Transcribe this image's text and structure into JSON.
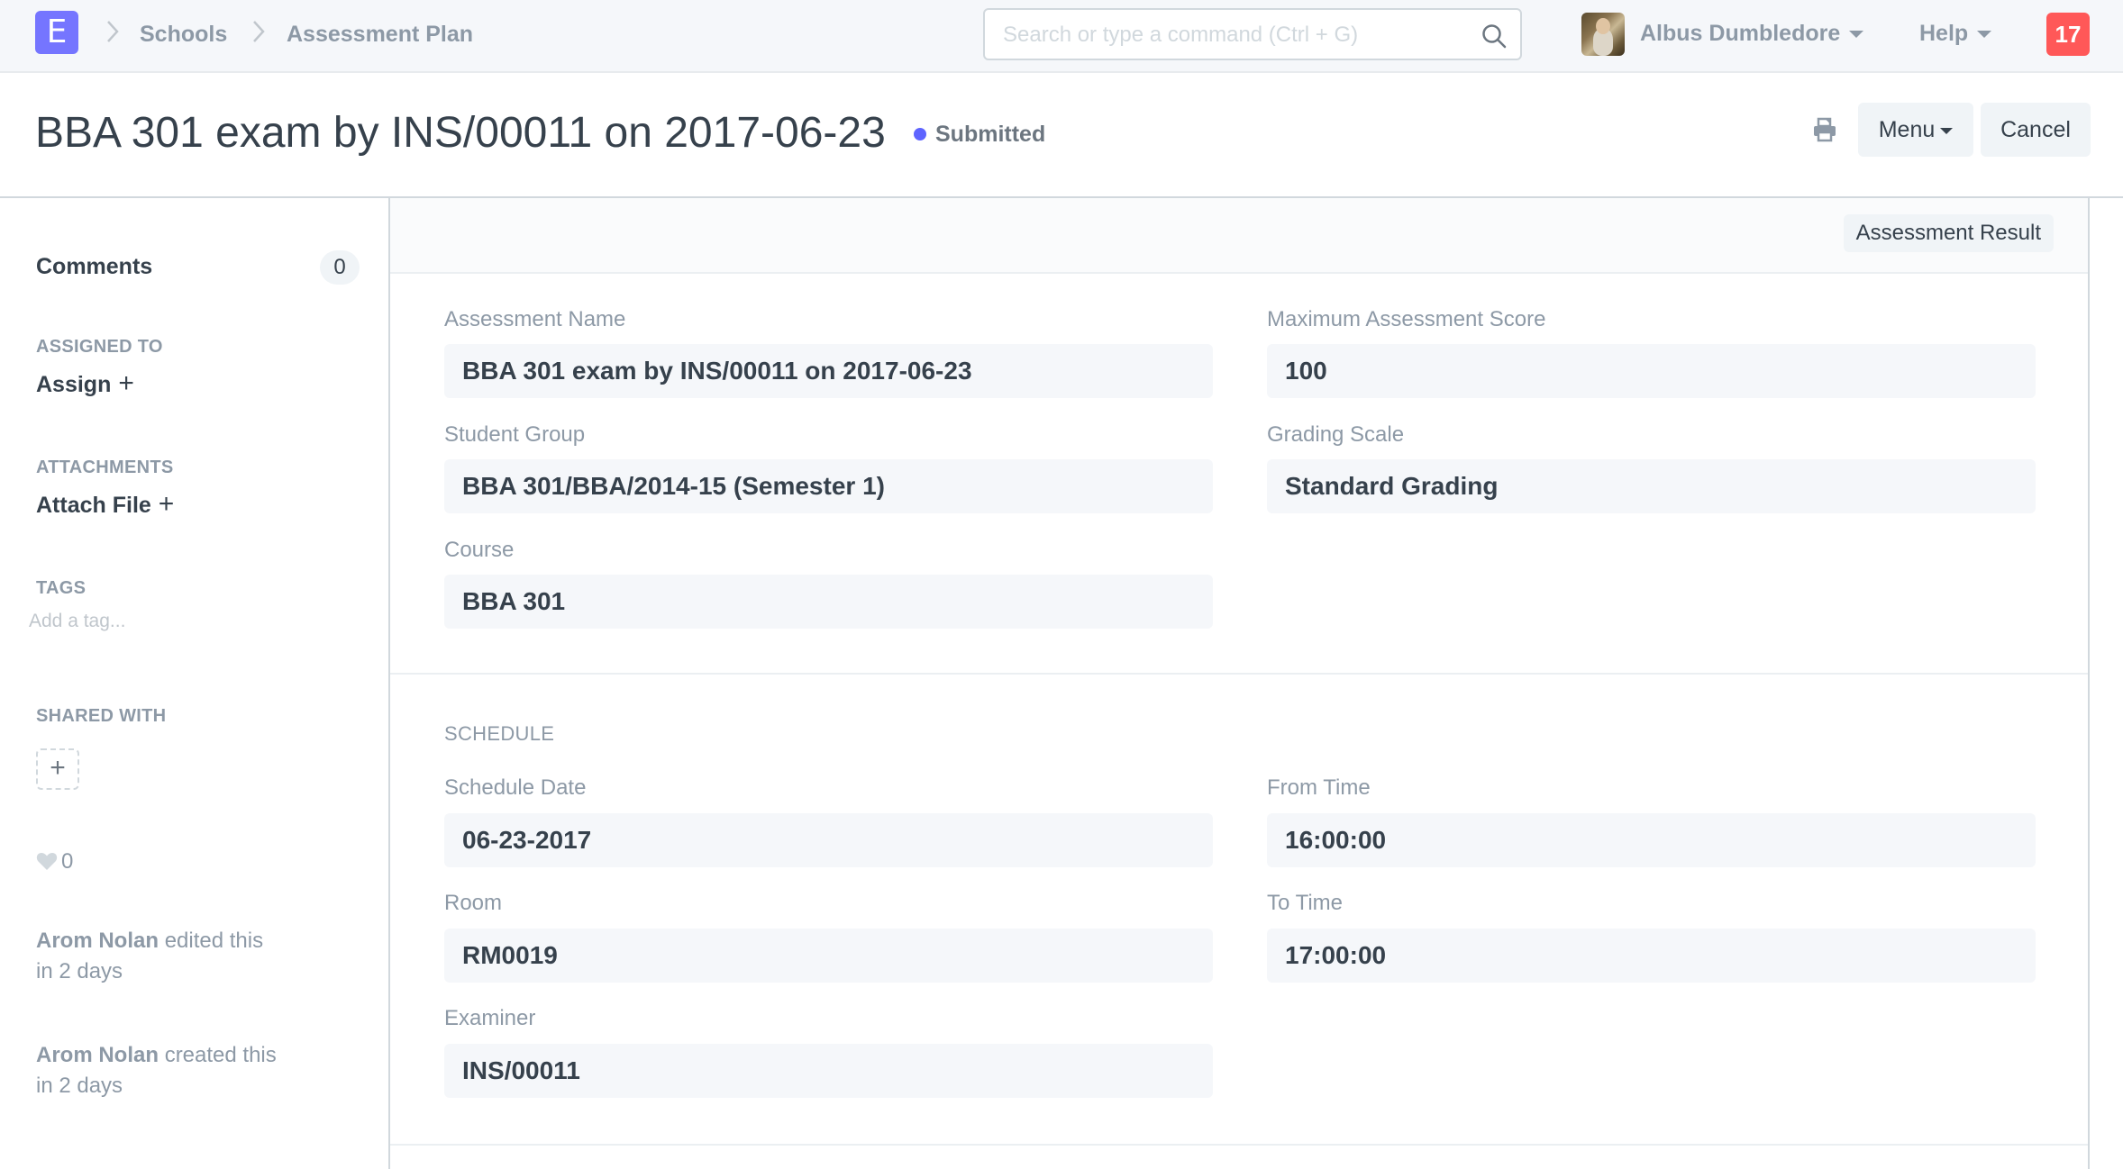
{
  "navbar": {
    "logo_letter": "E",
    "breadcrumbs": [
      "Schools",
      "Assessment Plan"
    ],
    "search_placeholder": "Search or type a command (Ctrl + G)",
    "user_name": "Albus Dumbledore",
    "help_label": "Help",
    "notification_count": "17"
  },
  "header": {
    "title": "BBA 301 exam by INS/00011 on 2017-06-23",
    "status": "Submitted",
    "status_color": "#5e64ff",
    "menu_label": "Menu",
    "cancel_label": "Cancel"
  },
  "sidebar": {
    "comments_label": "Comments",
    "comments_count": "0",
    "assigned_to_label": "ASSIGNED TO",
    "assign_label": "Assign",
    "attachments_label": "ATTACHMENTS",
    "attach_file_label": "Attach File",
    "tags_label": "TAGS",
    "tag_placeholder": "Add a tag...",
    "shared_with_label": "SHARED WITH",
    "likes_count": "0",
    "activity": [
      {
        "user": "Arom Nolan",
        "action": "edited this",
        "when": "in 2 days"
      },
      {
        "user": "Arom Nolan",
        "action": "created this",
        "when": "in 2 days"
      }
    ]
  },
  "form": {
    "toolbar_button": "Assessment Result",
    "section1": {
      "left": [
        {
          "label": "Assessment Name",
          "value": "BBA 301 exam by INS/00011 on 2017-06-23"
        },
        {
          "label": "Student Group",
          "value": "BBA 301/BBA/2014-15 (Semester 1)"
        },
        {
          "label": "Course",
          "value": "BBA 301"
        }
      ],
      "right": [
        {
          "label": "Maximum Assessment Score",
          "value": "100"
        },
        {
          "label": "Grading Scale",
          "value": "Standard Grading"
        }
      ]
    },
    "section2": {
      "title": "SCHEDULE",
      "left": [
        {
          "label": "Schedule Date",
          "value": "06-23-2017"
        },
        {
          "label": "Room",
          "value": "RM0019"
        },
        {
          "label": "Examiner",
          "value": "INS/00011"
        }
      ],
      "right": [
        {
          "label": "From Time",
          "value": "16:00:00"
        },
        {
          "label": "To Time",
          "value": "17:00:00"
        }
      ]
    }
  }
}
